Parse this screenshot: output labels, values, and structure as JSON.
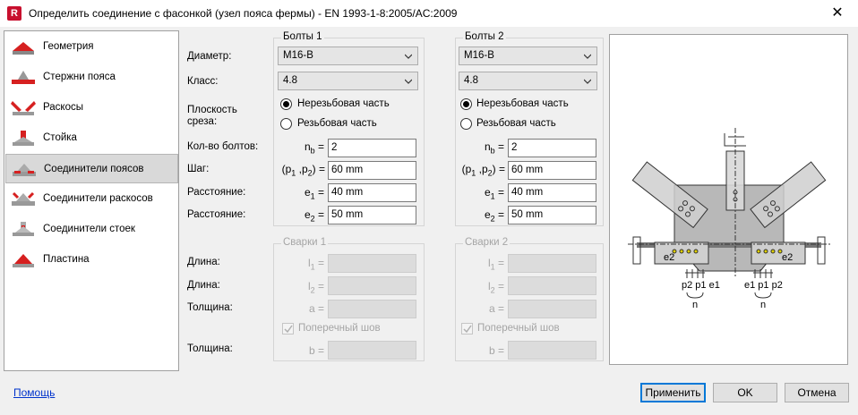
{
  "window": {
    "app_icon": "R",
    "title": "Определить соединение с фасонкой (узел пояса фермы) - EN 1993-1-8:2005/AC:2009",
    "close": "✕"
  },
  "sidebar": {
    "items": [
      {
        "label": "Геометрия"
      },
      {
        "label": "Стержни пояса"
      },
      {
        "label": "Раскосы"
      },
      {
        "label": "Стойка"
      },
      {
        "label": "Соединители поясов"
      },
      {
        "label": "Соединители раскосов"
      },
      {
        "label": "Соединители стоек"
      },
      {
        "label": "Пластина"
      }
    ],
    "selected_index": 4
  },
  "labels": {
    "diameter": "Диаметр:",
    "class": "Класс:",
    "shear_plane_1": "Плоскость",
    "shear_plane_2": "среза:",
    "bolt_count": "Кол-во болтов:",
    "pitch": "Шаг:",
    "distance1": "Расстояние:",
    "distance2": "Расстояние:",
    "length1": "Длина:",
    "length2": "Длина:",
    "thickness1": "Толщина:",
    "thickness2": "Толщина:"
  },
  "bolts1": {
    "title": "Болты 1",
    "diameter": "M16-B",
    "class": "4.8",
    "radio_unthreaded": "Нерезьбовая часть",
    "radio_threaded": "Резьбовая часть",
    "selected": "unthreaded",
    "nb": "2",
    "p": "60 mm",
    "e1": "40 mm",
    "e2": "50 mm"
  },
  "bolts2": {
    "title": "Болты 2",
    "diameter": "M16-B",
    "class": "4.8",
    "radio_unthreaded": "Нерезьбовая часть",
    "radio_threaded": "Резьбовая часть",
    "selected": "unthreaded",
    "nb": "2",
    "p": "60 mm",
    "e1": "40 mm",
    "e2": "50 mm"
  },
  "welds1": {
    "title": "Сварки 1",
    "transverse": "Поперечный шов",
    "transverse_checked": true,
    "l1": "",
    "l2": "",
    "a": "",
    "b": ""
  },
  "welds2": {
    "title": "Сварки 2",
    "transverse": "Поперечный шов",
    "transverse_checked": true,
    "l1": "",
    "l2": "",
    "a": "",
    "b": ""
  },
  "symbols": {
    "nb": "n",
    "nb_sub": "b",
    "p_open": "(p",
    "p1": "1",
    "p_mid": " ,p",
    "p2": "2",
    "p_close": ") =",
    "e": "e",
    "e1": "1",
    "e2": "2",
    "l": "l",
    "l1": "1",
    "l2": "2",
    "a": "a =",
    "b": "b =",
    "eq": "="
  },
  "diagram": {
    "e2_left": "e2",
    "e2_right": "e2",
    "labels_left": "p2 p1 e1",
    "labels_right": "e1 p1 p2",
    "n_left": "n",
    "n_right": "n"
  },
  "buttons": {
    "help": "Помощь",
    "apply": "Применить",
    "ok": "OK",
    "cancel": "Отмена"
  },
  "colors": {
    "accent": "#0078d7",
    "brand": "#c8102e",
    "link": "#0033cc"
  }
}
